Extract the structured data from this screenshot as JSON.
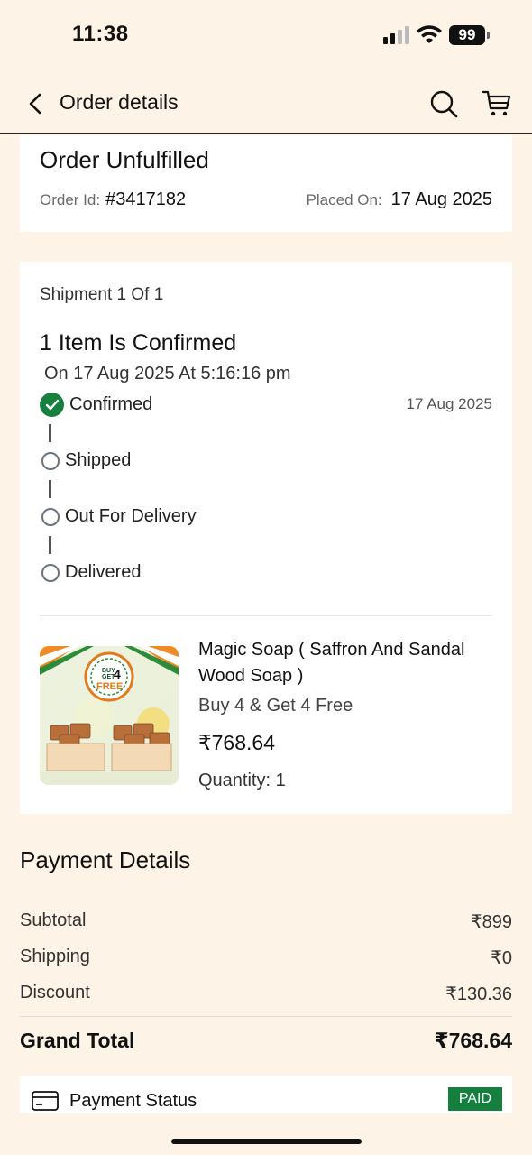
{
  "status_bar": {
    "time": "11:38",
    "battery": "99"
  },
  "header": {
    "title": "Order details"
  },
  "order": {
    "status": "Order Unfulfilled",
    "id_label": "Order Id:",
    "id_value": "#3417182",
    "placed_label": "Placed On:",
    "placed_value": "17 Aug 2025"
  },
  "shipment": {
    "count": "Shipment 1 Of 1",
    "headline": "1 Item Is Confirmed",
    "timestamp": "On 17 Aug 2025 At 5:16:16 pm",
    "steps": [
      {
        "label": "Confirmed",
        "date": "17 Aug 2025",
        "done": true
      },
      {
        "label": "Shipped",
        "done": false
      },
      {
        "label": "Out For Delivery",
        "done": false
      },
      {
        "label": "Delivered",
        "done": false
      }
    ]
  },
  "product": {
    "name": "Magic Soap ( Saffron And Sandal Wood Soap )",
    "variant": "Buy 4 & Get 4 Free",
    "price": "₹768.64",
    "quantity": "Quantity: 1",
    "badge_top": "BUY",
    "badge_mid": "GET",
    "badge_num": "4",
    "badge_free": "FREE"
  },
  "payment": {
    "title": "Payment Details",
    "rows": [
      {
        "label": "Subtotal",
        "value": "₹899"
      },
      {
        "label": "Shipping",
        "value": "₹0"
      },
      {
        "label": "Discount",
        "value": "₹130.36"
      }
    ],
    "grand_label": "Grand Total",
    "grand_value": "₹768.64",
    "status_label": "Payment Status",
    "status_value": "PAID"
  },
  "colors": {
    "background": "#fdf3e6",
    "success": "#18803f",
    "paid_badge": "#15803d"
  }
}
